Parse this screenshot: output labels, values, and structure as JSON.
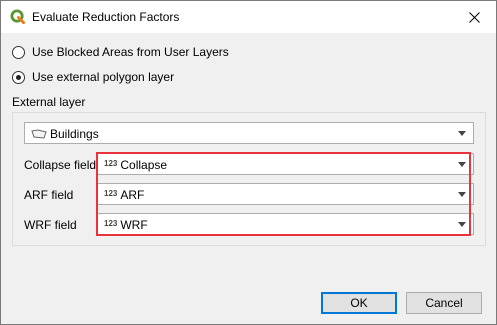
{
  "window": {
    "title": "Evaluate Reduction Factors"
  },
  "options": [
    {
      "label": "Use Blocked Areas from User Layers",
      "checked": false
    },
    {
      "label": "Use external polygon layer",
      "checked": true
    }
  ],
  "external_layer": {
    "group_label": "External layer",
    "layer_value": "Buildings",
    "layer_icon": "polygon-layer-icon"
  },
  "fields": [
    {
      "label": "Collapse field",
      "value": "Collapse",
      "type_icon": "123"
    },
    {
      "label": "ARF field",
      "value": "ARF",
      "type_icon": "123"
    },
    {
      "label": "WRF field",
      "value": "WRF",
      "type_icon": "123"
    }
  ],
  "buttons": {
    "ok": "OK",
    "cancel": "Cancel"
  },
  "colors": {
    "highlight": "#e8323c",
    "accent": "#0078d7",
    "qgis_green": "#589632"
  }
}
